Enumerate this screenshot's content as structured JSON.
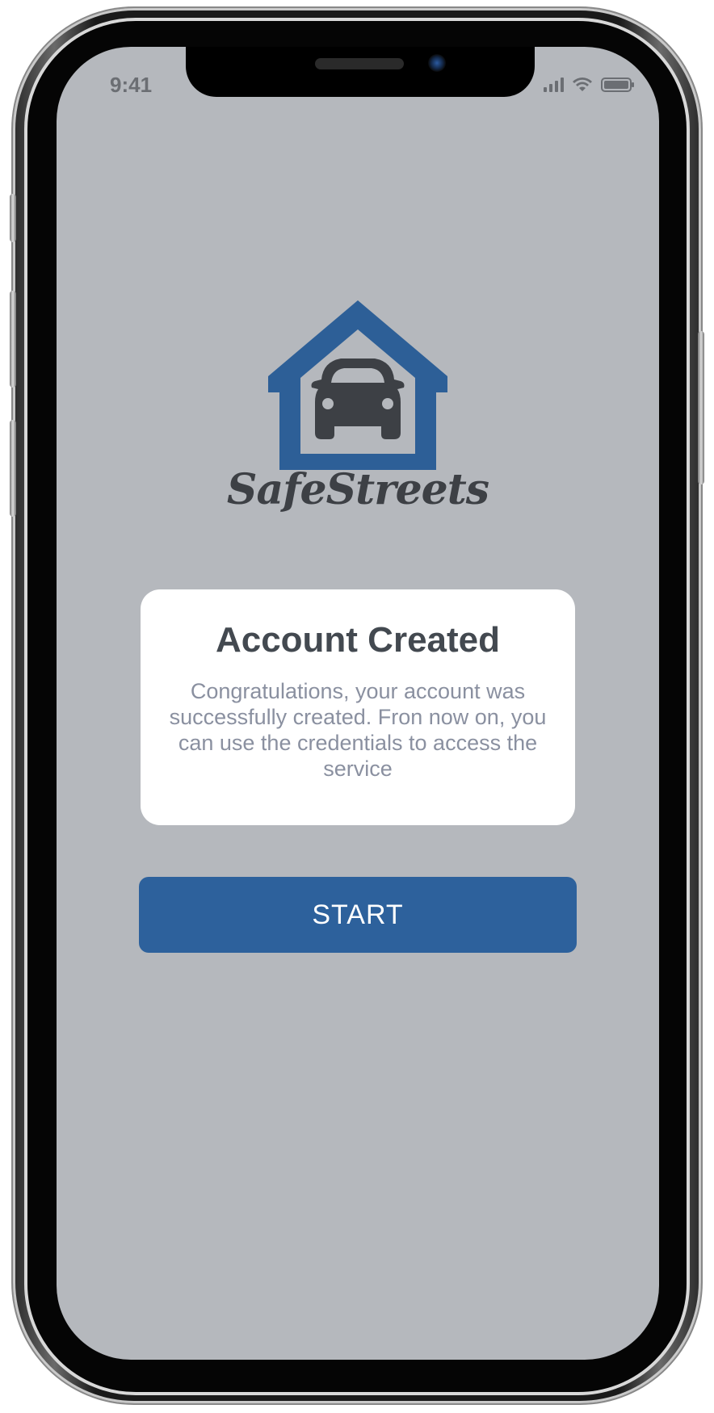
{
  "status_bar": {
    "time": "9:41",
    "icons": [
      "signal-icon",
      "wifi-icon",
      "battery-icon"
    ]
  },
  "brand": {
    "name": "SafeStreets",
    "logo_icon": "house-car-icon",
    "house_color": "#2d5f97",
    "car_color": "#3d4045"
  },
  "card": {
    "title": "Account Created",
    "body": "Congratulations, your account was successfully created. Fron now on, you can use the credentials to access the service"
  },
  "start_button": {
    "label": "START",
    "color": "#2d619c"
  },
  "colors": {
    "screen_background": "#b5b8bd",
    "card_background": "#ffffff",
    "title_text": "#434950",
    "body_text": "#8a90a0"
  }
}
